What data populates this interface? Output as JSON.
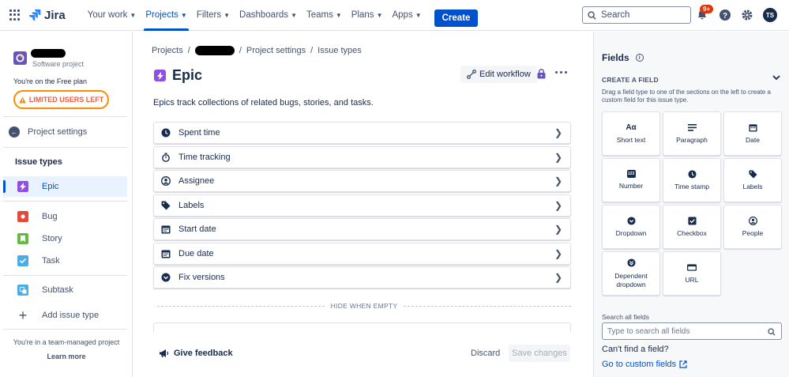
{
  "topbar": {
    "logo": "Jira",
    "nav": [
      {
        "label": "Your work",
        "active": false
      },
      {
        "label": "Projects",
        "active": true
      },
      {
        "label": "Filters",
        "active": false
      },
      {
        "label": "Dashboards",
        "active": false
      },
      {
        "label": "Teams",
        "active": false
      },
      {
        "label": "Plans",
        "active": false
      },
      {
        "label": "Apps",
        "active": false
      }
    ],
    "create_label": "Create",
    "search_placeholder": "Search",
    "notifications_badge": "9+",
    "avatar_initials": "TS"
  },
  "sidebar": {
    "project_type": "Software project",
    "plan_note": "You're on the Free plan",
    "limited_users_label": "LIMITED USERS LEFT",
    "back_label": "Project settings",
    "section_title": "Issue types",
    "issue_types": [
      {
        "label": "Epic",
        "color": "#904ee2",
        "icon": "lightning-icon",
        "selected": true
      },
      {
        "label": "Bug",
        "color": "#e5493a",
        "icon": "bug-icon",
        "selected": false
      },
      {
        "label": "Story",
        "color": "#63ba3c",
        "icon": "bookmark-icon",
        "selected": false
      },
      {
        "label": "Task",
        "color": "#4bade8",
        "icon": "check-icon",
        "selected": false
      },
      {
        "label": "Subtask",
        "color": "#4bade8",
        "icon": "subtask-icon",
        "selected": false
      }
    ],
    "add_issue_type_label": "Add issue type",
    "team_note": "You're in a team-managed project",
    "learn_more_label": "Learn more"
  },
  "main": {
    "breadcrumb": [
      "Projects",
      "Project settings",
      "Issue types"
    ],
    "title": "Epic",
    "edit_workflow_label": "Edit workflow",
    "description": "Epics track collections of related bugs, stories, and tasks.",
    "fields": [
      {
        "label": "Spent time",
        "icon": "clock-icon"
      },
      {
        "label": "Time tracking",
        "icon": "stopwatch-icon"
      },
      {
        "label": "Assignee",
        "icon": "person-icon"
      },
      {
        "label": "Labels",
        "icon": "tag-icon"
      },
      {
        "label": "Start date",
        "icon": "calendar-icon"
      },
      {
        "label": "Due date",
        "icon": "calendar-icon"
      },
      {
        "label": "Fix versions",
        "icon": "chevron-circle-icon"
      }
    ],
    "hide_when_empty_label": "HIDE WHEN EMPTY",
    "feedback_label": "Give feedback",
    "discard_label": "Discard",
    "save_label": "Save changes"
  },
  "fields_panel": {
    "title": "Fields",
    "create_field_title": "CREATE A FIELD",
    "create_field_hint": "Drag a field type to one of the sections on the left to create a custom field for this issue type.",
    "field_types": [
      {
        "label": "Short text",
        "icon": "text-aa-icon"
      },
      {
        "label": "Paragraph",
        "icon": "paragraph-icon"
      },
      {
        "label": "Date",
        "icon": "calendar-icon"
      },
      {
        "label": "Number",
        "icon": "number-icon"
      },
      {
        "label": "Time stamp",
        "icon": "clock-icon"
      },
      {
        "label": "Labels",
        "icon": "tag-icon"
      },
      {
        "label": "Dropdown",
        "icon": "dropdown-icon"
      },
      {
        "label": "Checkbox",
        "icon": "checkbox-icon"
      },
      {
        "label": "People",
        "icon": "person-icon"
      },
      {
        "label": "Dependent dropdown",
        "icon": "dependent-dropdown-icon"
      },
      {
        "label": "URL",
        "icon": "url-icon"
      }
    ],
    "short_text_icon_text": "Aα",
    "number_icon_text": "123",
    "search_label": "Search all fields",
    "search_placeholder": "Type to search all fields",
    "cant_find_label": "Can't find a field?",
    "custom_fields_link": "Go to custom fields"
  }
}
